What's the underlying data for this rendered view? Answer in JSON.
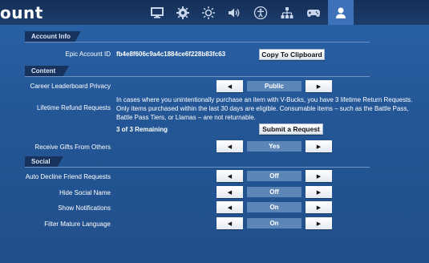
{
  "header": {
    "title": "ount",
    "tabs": [
      {
        "name": "monitor-icon",
        "active": false
      },
      {
        "name": "gear-icon",
        "active": false
      },
      {
        "name": "brightness-icon",
        "active": false
      },
      {
        "name": "speaker-icon",
        "active": false
      },
      {
        "name": "accessibility-icon",
        "active": false
      },
      {
        "name": "network-icon",
        "active": false
      },
      {
        "name": "gamepad-icon",
        "active": false
      },
      {
        "name": "user-icon",
        "active": true
      }
    ]
  },
  "account_info": {
    "header": "Account Info",
    "epic_id_label": "Epic Account ID",
    "epic_id_value": "fb4e8f606c9a4c1884ce6f228b83fc63",
    "copy_button": "Copy To Clipboard"
  },
  "content": {
    "header": "Content",
    "career_privacy_label": "Career Leaderboard Privacy",
    "career_privacy_value": "Public",
    "refund_label": "Lifetime Refund Requests",
    "refund_description": "In cases where you unintentionally purchase an item with V-Bucks, you have 3 lifetime Return Requests. Only items purchased within the last 30 days are eligible. Consumable items – such as the Battle Pass, Battle Pass Tiers, or Llamas – are not returnable.",
    "refund_remaining": "3 of 3 Remaining",
    "submit_button": "Submit a Request",
    "gifts_label": "Receive Gifts From Others",
    "gifts_value": "Yes"
  },
  "social": {
    "header": "Social",
    "rows": [
      {
        "label": "Auto Decline Friend Requests",
        "value": "Off"
      },
      {
        "label": "Hide Social Name",
        "value": "Off"
      },
      {
        "label": "Show Notifications",
        "value": "On"
      },
      {
        "label": "Filter Mature Language",
        "value": "On"
      }
    ]
  },
  "arrows": {
    "left": "◀",
    "right": "▶"
  }
}
